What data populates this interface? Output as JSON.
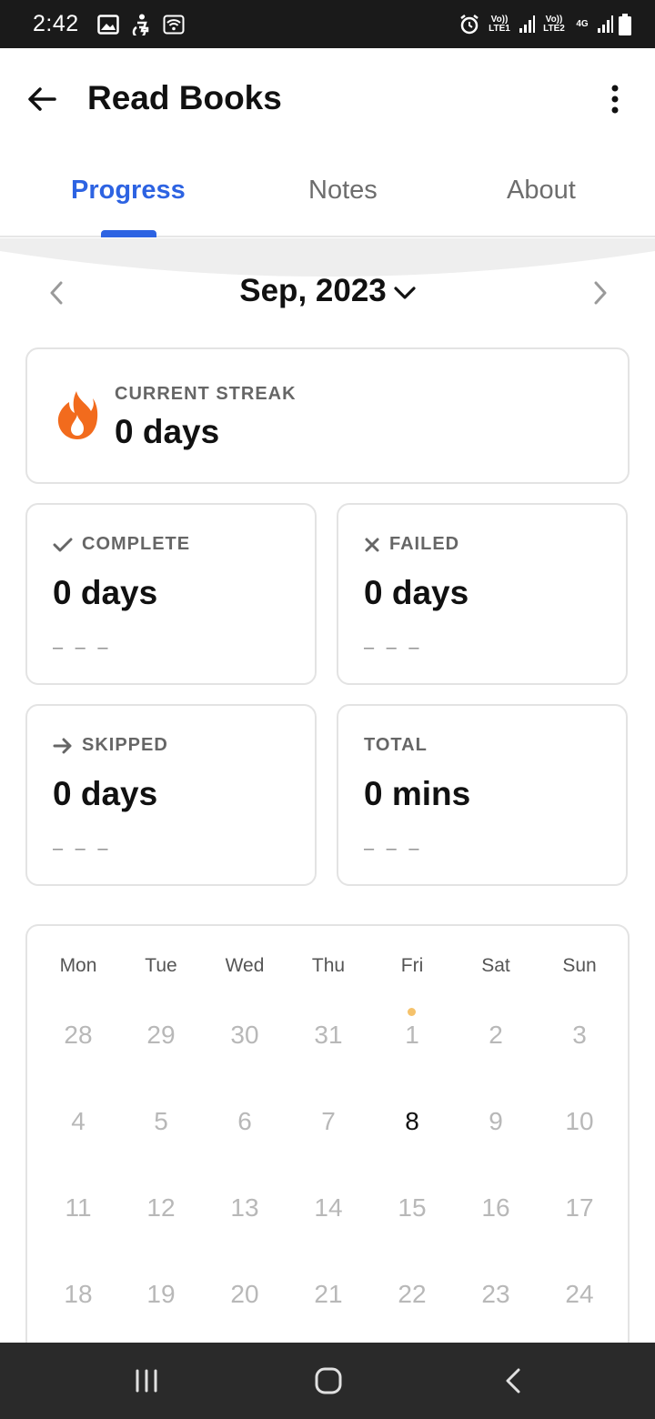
{
  "status_bar": {
    "time": "2:42",
    "sim1": "Vo)) LTE1",
    "sim2": "Vo)) LTE2",
    "network": "4G"
  },
  "app_bar": {
    "title": "Read Books"
  },
  "tabs": [
    {
      "label": "Progress",
      "active": true
    },
    {
      "label": "Notes",
      "active": false
    },
    {
      "label": "About",
      "active": false
    }
  ],
  "month_nav": {
    "label": "Sep, 2023"
  },
  "streak": {
    "label": "CURRENT STREAK",
    "value": "0 days"
  },
  "stats": [
    {
      "label": "COMPLETE",
      "value": "0 days",
      "trend": "– – –",
      "icon": "check-icon"
    },
    {
      "label": "FAILED",
      "value": "0 days",
      "trend": "– – –",
      "icon": "x-icon"
    },
    {
      "label": "SKIPPED",
      "value": "0 days",
      "trend": "– – –",
      "icon": "arrow-right-icon"
    },
    {
      "label": "TOTAL",
      "value": "0 mins",
      "trend": "– – –",
      "icon": ""
    }
  ],
  "calendar": {
    "weekdays": [
      "Mon",
      "Tue",
      "Wed",
      "Thu",
      "Fri",
      "Sat",
      "Sun"
    ],
    "weeks": [
      [
        "28",
        "29",
        "30",
        "31",
        "1",
        "2",
        "3"
      ],
      [
        "4",
        "5",
        "6",
        "7",
        "8",
        "9",
        "10"
      ],
      [
        "11",
        "12",
        "13",
        "14",
        "15",
        "16",
        "17"
      ],
      [
        "18",
        "19",
        "20",
        "21",
        "22",
        "23",
        "24"
      ]
    ],
    "today": "8",
    "dot_on": "1"
  },
  "colors": {
    "accent": "#2d63e2",
    "flame": "#f26b1d",
    "dot": "#f5c26b"
  }
}
